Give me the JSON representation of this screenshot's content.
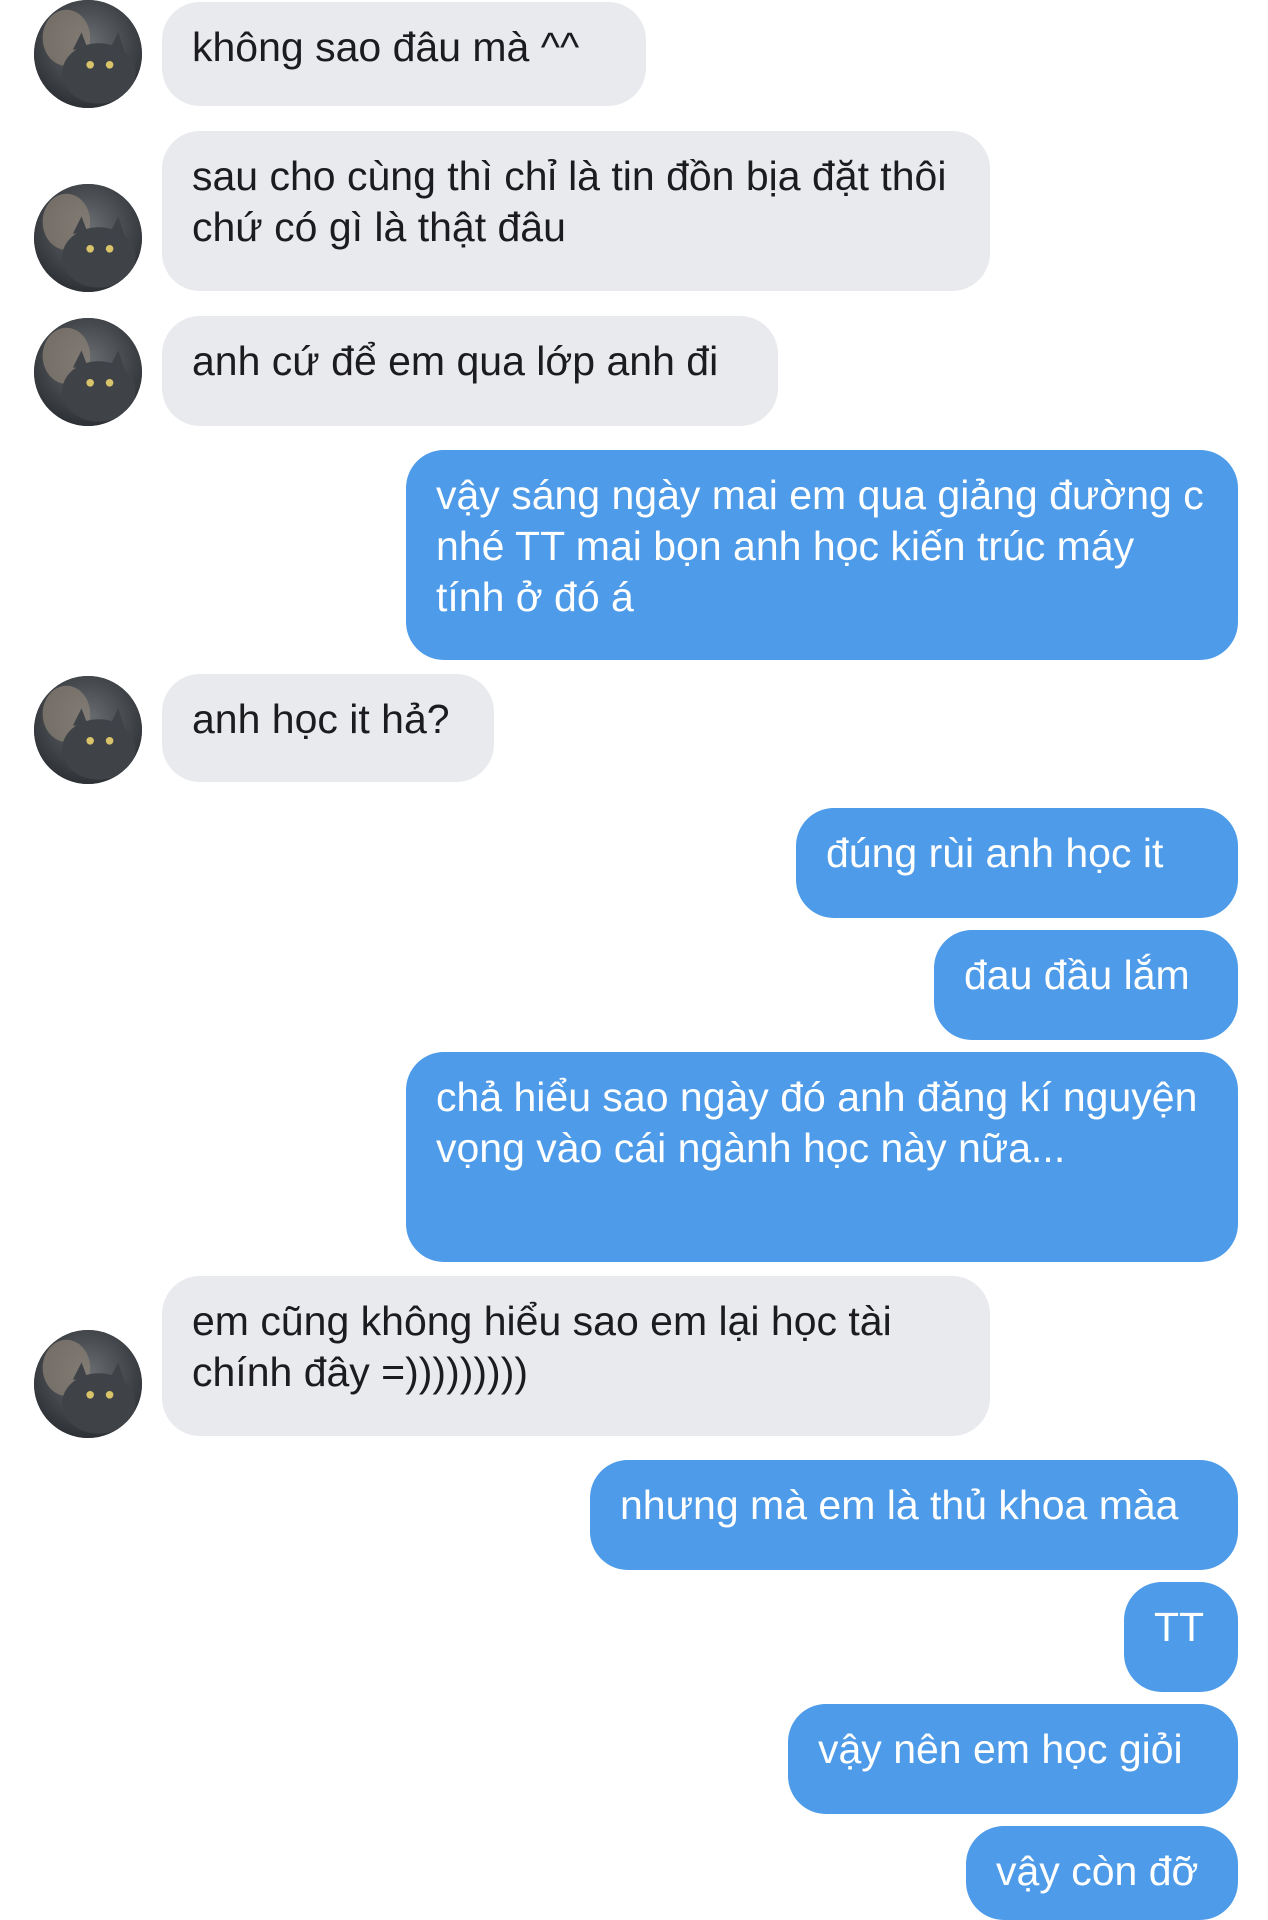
{
  "conversation": {
    "messages": [
      {
        "text": "không sao đâu mà ^^"
      },
      {
        "text": "sau cho cùng thì chỉ là tin đồn bịa đặt thôi chứ có gì là thật đâu"
      },
      {
        "text": "anh cứ để em qua lớp anh đi"
      },
      {
        "text": "vậy sáng ngày mai em qua giảng đường c nhé TT mai bọn anh học kiến trúc máy tính ở đó á"
      },
      {
        "text": "anh học it hả?"
      },
      {
        "text": "đúng rùi anh học it"
      },
      {
        "text": "đau đầu lắm"
      },
      {
        "text": "chả hiểu sao ngày đó anh đăng kí nguyện vọng vào cái ngành học này nữa..."
      },
      {
        "text": "em cũng không hiểu sao em lại học tài chính đây =)))))))))"
      },
      {
        "text": "nhưng mà em là thủ khoa màa"
      },
      {
        "text": "TT"
      },
      {
        "text": "vậy nên em học giỏi"
      },
      {
        "text": "vậy còn đỡ"
      }
    ]
  },
  "colors": {
    "incoming_bubble": "#e9eaee",
    "outgoing_bubble": "#4d9be9",
    "incoming_text": "#1c1c1e",
    "outgoing_text": "#ffffff"
  }
}
